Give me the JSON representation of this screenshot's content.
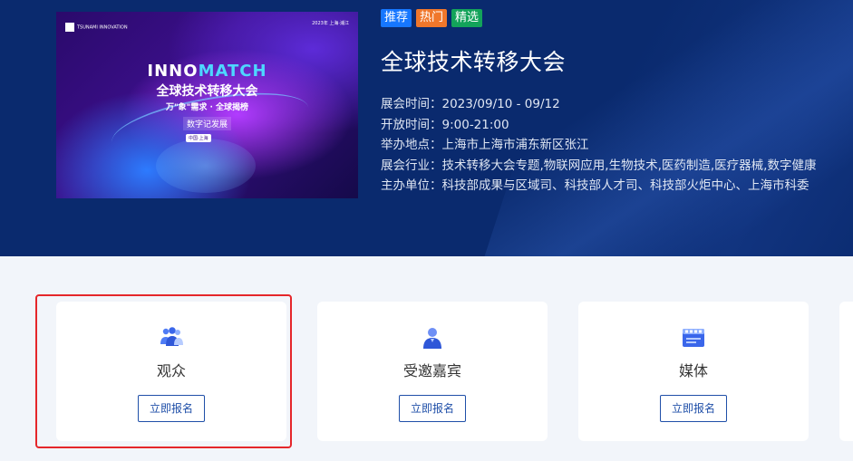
{
  "poster": {
    "logo_text": "TSUNAMI INNOVATION",
    "date_text": "2023年 上海·浦江",
    "brand_left": "INNO",
    "brand_right": "MATCH",
    "title": "全球技术转移大会",
    "subtitle": "万\"象\"需求 · 全球揭榜",
    "tagline": "数字记发展",
    "badge": "中国·上海"
  },
  "tags": [
    "推荐",
    "热门",
    "精选"
  ],
  "event": {
    "title": "全球技术转移大会",
    "info": [
      "展会时间：2023/09/10 - 09/12",
      "开放时间：9:00-21:00",
      "举办地点：上海市上海市浦东新区张江",
      "展会行业：技术转移大会专题,物联网应用,生物技术,医药制造,医疗器械,数字健康",
      "主办单位：科技部成果与区域司、科技部人才司、科技部火炬中心、上海市科委"
    ]
  },
  "cards": [
    {
      "label": "观众",
      "button": "立即报名",
      "icon": "audience-icon"
    },
    {
      "label": "受邀嘉宾",
      "button": "立即报名",
      "icon": "guest-icon"
    },
    {
      "label": "媒体",
      "button": "立即报名",
      "icon": "media-icon"
    }
  ],
  "colors": {
    "hero_bg": "#0a2a6e",
    "accent": "#1f4fa8",
    "tag_recommend": "#1677ff",
    "tag_hot": "#f0772b",
    "tag_select": "#13a35a",
    "highlight": "#e5262a"
  }
}
